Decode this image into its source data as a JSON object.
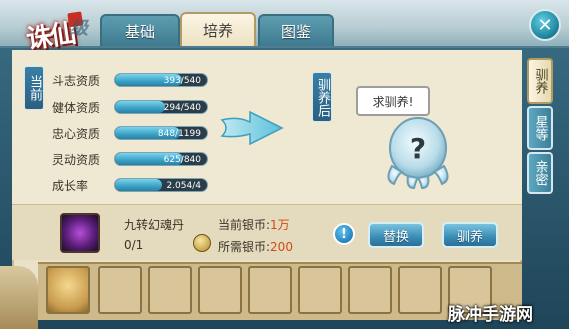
{
  "app": {
    "logo_text": "诛仙",
    "logo_tail": "级",
    "watermark": "脉冲手游网"
  },
  "tabs": [
    {
      "label": "基础",
      "active": false
    },
    {
      "label": "培养",
      "active": true
    },
    {
      "label": "图鉴",
      "active": false
    }
  ],
  "right_tabs": [
    {
      "label": "驯养",
      "active": true
    },
    {
      "label": "星等",
      "active": false
    },
    {
      "label": "亲密",
      "active": false
    }
  ],
  "labels": {
    "current": "当前",
    "after_train": "驯养后"
  },
  "stats": [
    {
      "label": "斗志资质",
      "value": "393/540",
      "fill": 0.73
    },
    {
      "label": "健体资质",
      "value": "294/540",
      "fill": 0.54
    },
    {
      "label": "忠心资质",
      "value": "848/1199",
      "fill": 0.71
    },
    {
      "label": "灵动资质",
      "value": "625/840",
      "fill": 0.74
    },
    {
      "label": "成长率",
      "value": "2.054/4",
      "fill": 0.51
    }
  ],
  "speech": "求驯养!",
  "item": {
    "name": "九转幻魂丹",
    "count": "0/1",
    "current_silver_label": "当前银币:",
    "current_silver_value": "1万",
    "required_silver_label": "所需银币:",
    "required_silver_value": "200"
  },
  "buttons": {
    "replace": "替换",
    "train": "驯养",
    "info": "!"
  },
  "colors": {
    "accent": "#3b8cb4",
    "highlight": "#d24a13",
    "panel": "#e9e1c8"
  }
}
